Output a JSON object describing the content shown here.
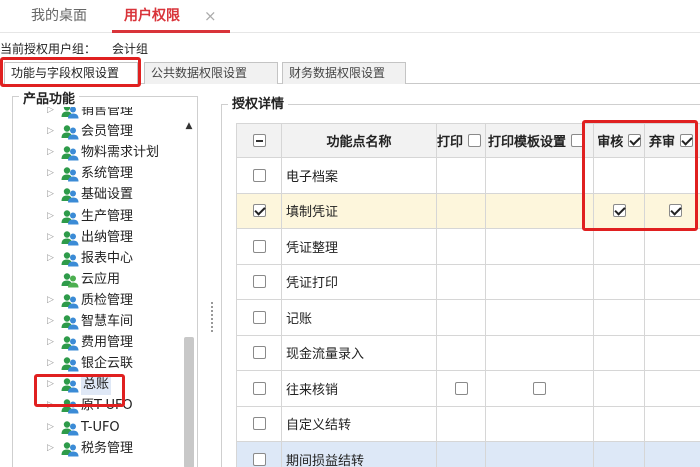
{
  "top_tabs": [
    {
      "label": "我的桌面"
    },
    {
      "label": "用户权限",
      "close": "×"
    }
  ],
  "group": {
    "label": "当前授权用户组：",
    "value": "会计组"
  },
  "sub_tabs": [
    {
      "label": "功能与字段权限设置"
    },
    {
      "label": "公共数据权限设置"
    },
    {
      "label": "财务数据权限设置"
    }
  ],
  "left_panel": {
    "title": "产品功能",
    "items": [
      {
        "label": "销售管理",
        "arrow": "▷"
      },
      {
        "label": "会员管理",
        "arrow": "▷"
      },
      {
        "label": "物料需求计划",
        "arrow": "▷"
      },
      {
        "label": "系统管理",
        "arrow": "▷"
      },
      {
        "label": "基础设置",
        "arrow": "▷"
      },
      {
        "label": "生产管理",
        "arrow": "▷"
      },
      {
        "label": "出纳管理",
        "arrow": "▷"
      },
      {
        "label": "报表中心",
        "arrow": "▷"
      },
      {
        "label": "云应用",
        "arrow": ""
      },
      {
        "label": "质检管理",
        "arrow": "▷"
      },
      {
        "label": "智慧车间",
        "arrow": "▷"
      },
      {
        "label": "费用管理",
        "arrow": "▷"
      },
      {
        "label": "银企云联",
        "arrow": "▷"
      },
      {
        "label": "总账",
        "arrow": "▷"
      },
      {
        "label": "原T-UFO",
        "arrow": "▷"
      },
      {
        "label": "T-UFO",
        "arrow": "▷"
      },
      {
        "label": "税务管理",
        "arrow": "▷"
      }
    ]
  },
  "right_panel": {
    "title": "授权详情",
    "columns": {
      "name": "功能点名称",
      "print": "打印",
      "print_template": "打印模板设置",
      "audit": "审核",
      "unaudit": "弃审"
    },
    "rows": [
      {
        "name": "电子档案"
      },
      {
        "name": "填制凭证"
      },
      {
        "name": "凭证整理"
      },
      {
        "name": "凭证打印"
      },
      {
        "name": "记账"
      },
      {
        "name": "现金流量录入"
      },
      {
        "name": "往来核销"
      },
      {
        "name": "自定义结转"
      },
      {
        "name": "期间损益结转"
      }
    ]
  },
  "colors": {
    "accent": "#d9343a",
    "highlight_box": "#e02020",
    "row_highlight": "#fdf6dc",
    "row_selected": "#dde8f7"
  },
  "icons": {
    "user_group": "user-group-icon",
    "close": "close-icon",
    "expand": "expand-arrow-icon",
    "scroll_up": "scroll-up-icon"
  }
}
